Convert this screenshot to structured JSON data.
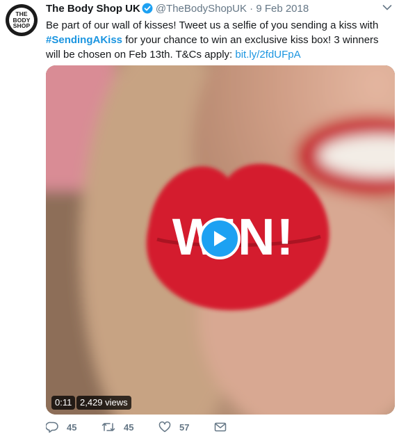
{
  "account": {
    "logo_lines": [
      "THE",
      "BODY",
      "SHOP"
    ],
    "display_name": "The Body Shop UK",
    "handle": "@TheBodyShopUK",
    "separator": "·",
    "date": "9 Feb 2018"
  },
  "tweet": {
    "text_part1": "Be part of our wall of kisses! Tweet us a selfie of you sending a kiss with",
    "hashtag": "#SendingAKiss",
    "text_part2": " for your chance to win an exclusive kiss box! 3 winners will be chosen on Feb 13th. T&Cs apply: ",
    "link": "bit.ly/2fdUFpA"
  },
  "video": {
    "overlay_text": "WIN!",
    "duration": "0:11",
    "views": "2,429 views"
  },
  "actions": {
    "replies": "45",
    "retweets": "45",
    "likes": "57"
  },
  "colors": {
    "link": "#1b95e0",
    "verified": "#1da1f2",
    "muted": "#657786",
    "kiss": "#d41f2f"
  },
  "icons": [
    "verified-icon",
    "caret-down-icon",
    "play-icon",
    "reply-icon",
    "retweet-icon",
    "like-icon",
    "message-icon"
  ]
}
